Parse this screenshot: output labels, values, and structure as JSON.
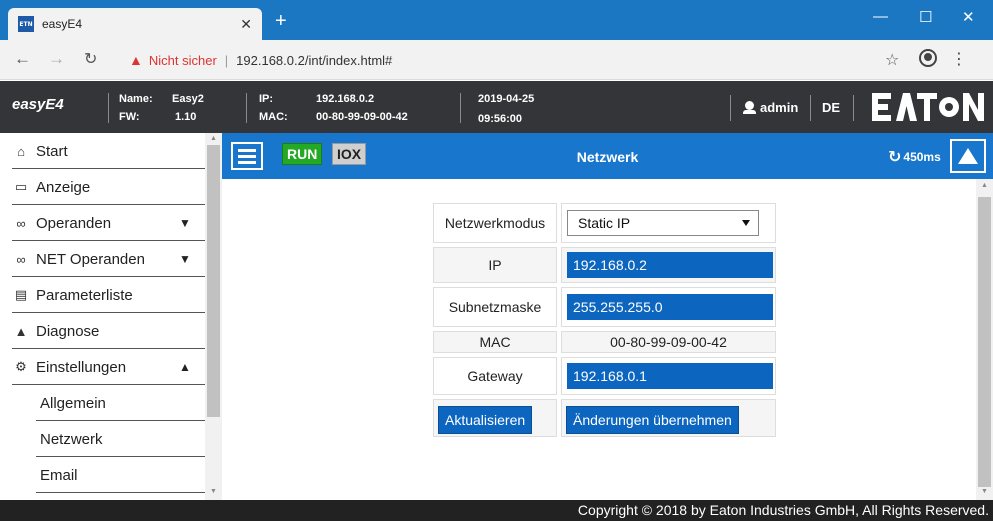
{
  "browser": {
    "tab_title": "easyE4",
    "favicon_text": "ETN",
    "security_label": "Nicht sicher",
    "url": "192.168.0.2/int/index.html#"
  },
  "header": {
    "brand": "easyE4",
    "name_label": "Name:",
    "name_value": "Easy2",
    "fw_label": "FW:",
    "fw_value": "1.10",
    "ip_label": "IP:",
    "ip_value": "192.168.0.2",
    "mac_label": "MAC:",
    "mac_value": "00-80-99-09-00-42",
    "date": "2019-04-25",
    "time": "09:56:00",
    "user": "admin",
    "language": "DE",
    "logo_text": "EATON"
  },
  "sidebar": {
    "items": [
      {
        "label": "Start",
        "icon": "home-icon"
      },
      {
        "label": "Anzeige",
        "icon": "monitor-icon"
      },
      {
        "label": "Operanden",
        "icon": "glasses-icon"
      },
      {
        "label": "NET Operanden",
        "icon": "glasses-icon"
      },
      {
        "label": "Parameterliste",
        "icon": "list-icon"
      },
      {
        "label": "Diagnose",
        "icon": "warning-icon"
      },
      {
        "label": "Einstellungen",
        "icon": "gear-icon"
      }
    ],
    "sub_items": [
      {
        "label": "Allgemein"
      },
      {
        "label": "Netzwerk"
      },
      {
        "label": "Email"
      }
    ]
  },
  "toolbar": {
    "run": "RUN",
    "iox": "IOX",
    "title": "Netzwerk",
    "cycle": "450ms"
  },
  "form": {
    "mode_label": "Netzwerkmodus",
    "mode_value": "Static IP",
    "ip_label": "IP",
    "ip_value": "192.168.0.2",
    "subnet_label": "Subnetzmaske",
    "subnet_value": "255.255.255.0",
    "mac_label": "MAC",
    "mac_value": "00-80-99-09-00-42",
    "gateway_label": "Gateway",
    "gateway_value": "192.168.0.1",
    "refresh_button": "Aktualisieren",
    "apply_button": "Änderungen übernehmen"
  },
  "footer": {
    "copyright": "Copyright © 2018 by Eaton Industries GmbH, All Rights Reserved."
  },
  "colors": {
    "chrome_blue": "#1c77c3",
    "toolbar_blue": "#1876cc",
    "input_blue": "#0c66bf",
    "run_green": "#25a825",
    "header_dark": "#333538"
  }
}
